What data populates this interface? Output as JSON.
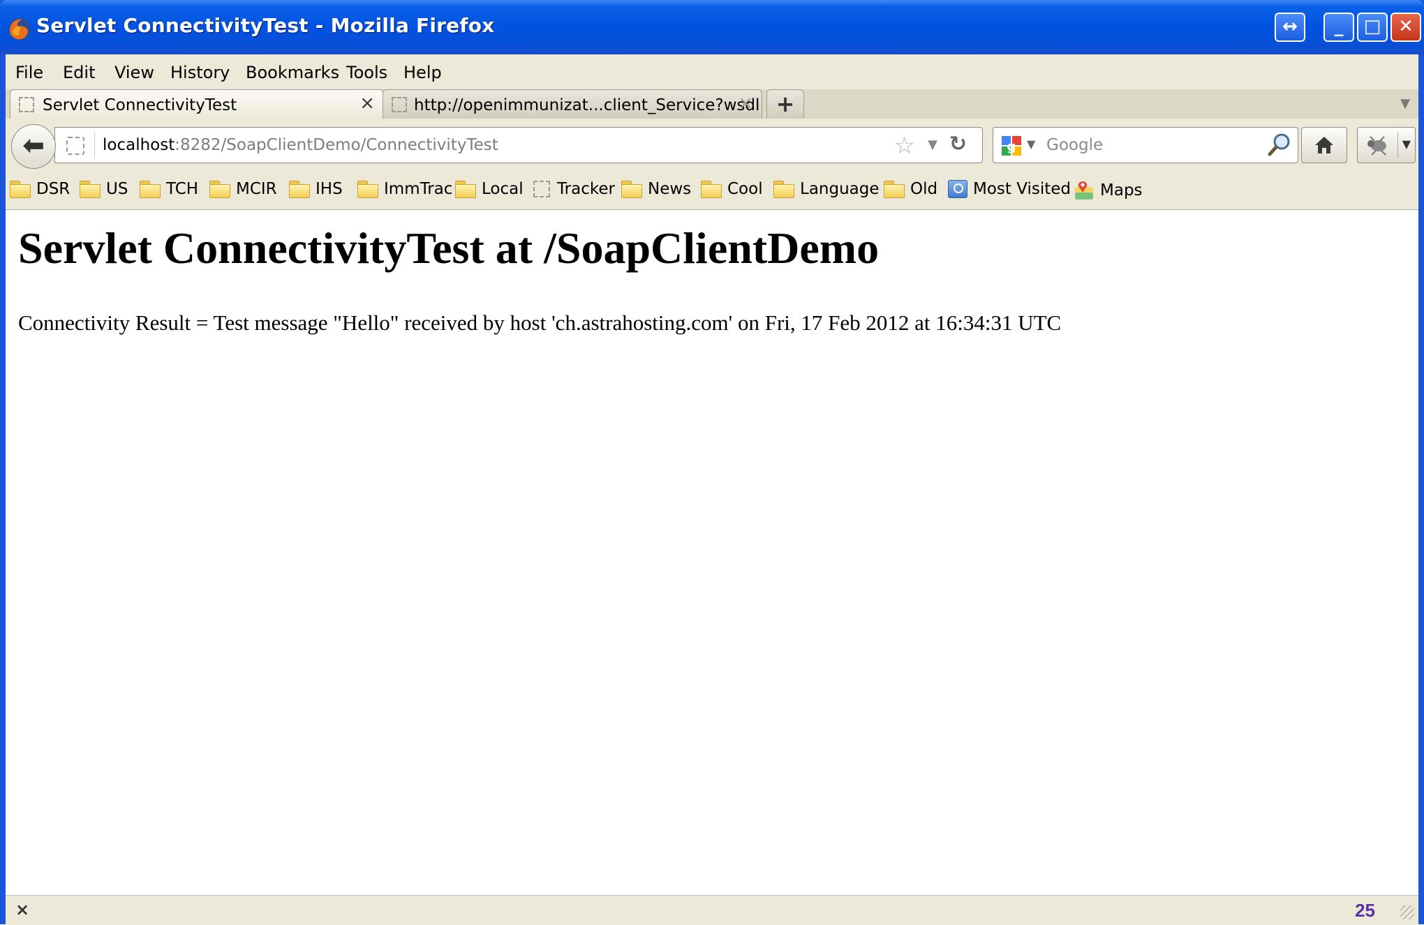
{
  "window": {
    "title": "Servlet ConnectivityTest - Mozilla Firefox",
    "controls": {
      "restore": "↔",
      "minimize": "_",
      "maximize": "□",
      "close": "✕"
    }
  },
  "menu": [
    "File",
    "Edit",
    "View",
    "History",
    "Bookmarks",
    "Tools",
    "Help"
  ],
  "tabs": [
    {
      "label": "Servlet ConnectivityTest",
      "active": true,
      "close": "×"
    },
    {
      "label": "http://openimmunizat...client_Service?wsdl",
      "active": false,
      "close": "×"
    }
  ],
  "new_tab": "+",
  "navbar": {
    "url_host": "localhost",
    "url_path": ":8282/SoapClientDemo/ConnectivityTest",
    "search_placeholder": "Google"
  },
  "bookmarks": [
    {
      "label": "DSR",
      "icon": "folder-icon"
    },
    {
      "label": "US",
      "icon": "folder-icon"
    },
    {
      "label": "TCH",
      "icon": "folder-icon"
    },
    {
      "label": "MCIR",
      "icon": "folder-icon"
    },
    {
      "label": "IHS",
      "icon": "folder-icon"
    },
    {
      "label": "ImmTrac",
      "icon": "folder-icon"
    },
    {
      "label": "Local",
      "icon": "folder-icon"
    },
    {
      "label": "Tracker",
      "icon": "page-icon"
    },
    {
      "label": "News",
      "icon": "folder-icon"
    },
    {
      "label": "Cool",
      "icon": "folder-icon"
    },
    {
      "label": "Language",
      "icon": "folder-icon"
    },
    {
      "label": "Old",
      "icon": "folder-icon"
    },
    {
      "label": "Most Visited",
      "icon": "most-visited-icon"
    },
    {
      "label": "Maps",
      "icon": "maps-icon"
    }
  ],
  "page": {
    "heading": "Servlet ConnectivityTest at /SoapClientDemo",
    "result": "Connectivity Result = Test message \"Hello\" received by host 'ch.astrahosting.com' on Fri, 17 Feb 2012 at 16:34:31 UTC"
  },
  "status": {
    "close": "×",
    "page_number": "25"
  },
  "colors": {
    "titlebar": "#0053e0",
    "chrome": "#ece9d8",
    "page_number": "#5a32a6"
  }
}
